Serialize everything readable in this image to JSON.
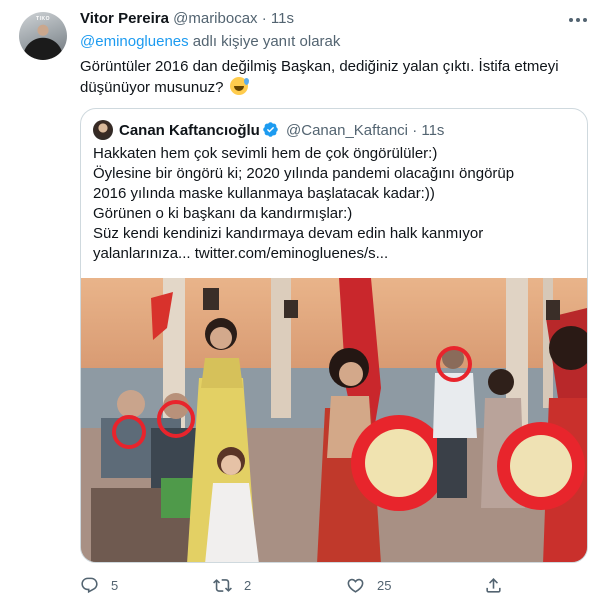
{
  "tweet": {
    "author_name": "Vitor Pereira",
    "author_handle": "@maribocax",
    "separator": "·",
    "time": "11s",
    "avatar_text": "TIKO",
    "reply_mention": "@eminogluenes",
    "reply_suffix": " adlı kişiye yanıt olarak",
    "text": "Görüntüler 2016 dan değilmiş Başkan, dediğiniz yalan çıktı. İstifa etmeyi düşünüyor musunuz?",
    "emoji": "sweat-smile-emoji"
  },
  "quoted": {
    "author_name": "Canan Kaftancıoğlu",
    "author_handle": "@Canan_Kaftanci",
    "separator": "·",
    "time": "11s",
    "lines": [
      "Hakkaten hem çok sevimli hem de çok öngörülüler:)",
      "Öylesine bir öngörü ki; 2020 yılında pandemi olacağını öngörüp",
      "2016 yılında maske kullanmaya başlatacak kadar:))",
      "Görünen o ki başkanı da kandırmışlar:)",
      "Süz kendi kendinizi kandırmaya devam edin halk kanmıyor",
      "yalanlarınıza...  twitter.com/eminogluenes/s..."
    ]
  },
  "actions": {
    "reply_count": "5",
    "retweet_count": "2",
    "like_count": "25"
  },
  "colors": {
    "accent": "#1d9bf0",
    "secondary_text": "#536471",
    "border": "#cfd9de",
    "highlight_circle": "#e8242c"
  }
}
